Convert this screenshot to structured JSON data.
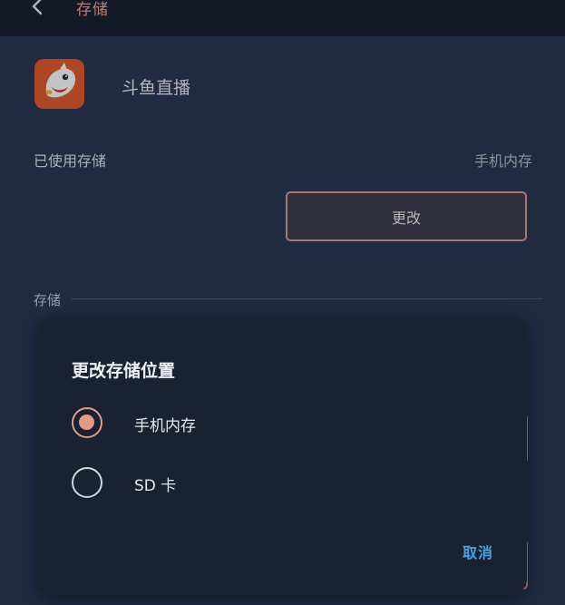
{
  "header": {
    "title": "存储",
    "back_icon": "chevron-left-icon"
  },
  "app": {
    "name": "斗鱼直播",
    "icon": "shark-app-icon"
  },
  "storage_used": {
    "label": "已使用存储",
    "value": "手机内存",
    "change_label": "更改"
  },
  "storage_section": {
    "label": "存储"
  },
  "dialog": {
    "title": "更改存储位置",
    "options": [
      {
        "label": "手机内存",
        "selected": true
      },
      {
        "label": "SD 卡",
        "selected": false
      }
    ],
    "cancel_label": "取消"
  },
  "colors": {
    "background": "#273450",
    "topbar": "#161d2b",
    "accent": "#e49a86",
    "dialog": "#1a2232",
    "link": "#4aa3df"
  }
}
